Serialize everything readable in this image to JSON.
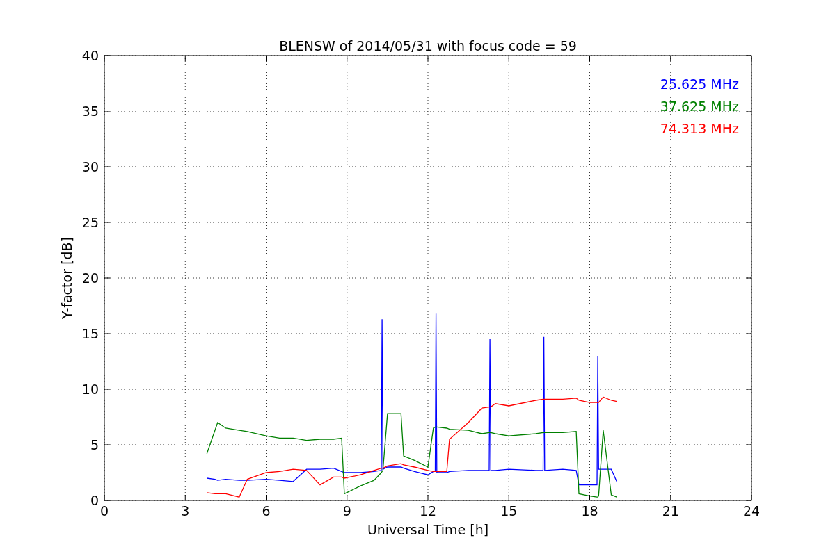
{
  "figure": {
    "chart_data": {
      "type": "line",
      "title": "BLENSW of 2014/05/31 with focus code = 59",
      "xlabel": "Universal Time [h]",
      "ylabel": "Y-factor [dB]",
      "grid": true,
      "x": [
        3.8,
        4.1,
        4.2,
        4.5,
        5.0,
        5.3,
        6.0,
        6.5,
        7.0,
        7.5,
        8.0,
        8.5,
        8.8,
        8.9,
        9.5,
        10.0,
        10.27,
        10.3,
        10.33,
        10.5,
        11.0,
        11.1,
        11.5,
        12.0,
        12.2,
        12.27,
        12.3,
        12.33,
        12.7,
        12.8,
        13.5,
        14.0,
        14.27,
        14.3,
        14.33,
        14.5,
        15.0,
        16.0,
        16.27,
        16.3,
        16.33,
        17.0,
        17.5,
        17.6,
        18.0,
        18.27,
        18.3,
        18.33,
        18.5,
        18.8,
        19.0
      ],
      "series": [
        {
          "name": "25.625 MHz",
          "color": "#0000ff",
          "values": [
            2.0,
            1.9,
            1.8,
            1.9,
            1.8,
            1.8,
            1.9,
            1.8,
            1.7,
            2.8,
            2.8,
            2.9,
            2.6,
            2.5,
            2.5,
            2.6,
            2.7,
            16.3,
            2.8,
            3.0,
            3.0,
            2.9,
            2.6,
            2.3,
            2.6,
            2.6,
            16.8,
            2.5,
            2.5,
            2.6,
            2.7,
            2.7,
            2.7,
            14.5,
            2.7,
            2.7,
            2.8,
            2.7,
            2.7,
            14.7,
            2.7,
            2.8,
            2.7,
            1.4,
            1.4,
            1.4,
            13.0,
            2.8,
            2.8,
            2.8,
            1.7
          ]
        },
        {
          "name": "37.625 MHz",
          "color": "#008000",
          "values": [
            4.2,
            6.3,
            7.0,
            6.5,
            6.3,
            6.2,
            5.8,
            5.6,
            5.6,
            5.4,
            5.5,
            5.5,
            5.6,
            0.6,
            1.3,
            1.8,
            2.5,
            2.6,
            2.7,
            7.8,
            7.8,
            4.0,
            3.6,
            3.0,
            6.5,
            6.6,
            6.6,
            6.6,
            6.5,
            6.4,
            6.3,
            6.0,
            6.1,
            6.1,
            6.1,
            6.0,
            5.8,
            6.0,
            6.1,
            6.1,
            6.1,
            6.1,
            6.2,
            0.6,
            0.4,
            0.3,
            0.3,
            0.4,
            6.3,
            0.5,
            0.3
          ]
        },
        {
          "name": "74.313 MHz",
          "color": "#ff0000",
          "values": [
            0.7,
            0.6,
            0.6,
            0.6,
            0.3,
            1.9,
            2.5,
            2.6,
            2.8,
            2.7,
            1.4,
            2.1,
            2.1,
            2.0,
            2.3,
            2.7,
            2.9,
            2.9,
            2.9,
            3.1,
            3.3,
            3.2,
            3.0,
            2.7,
            2.6,
            2.6,
            2.6,
            2.6,
            2.6,
            5.5,
            7.0,
            8.3,
            8.4,
            8.4,
            8.4,
            8.7,
            8.5,
            9.0,
            9.1,
            9.1,
            9.1,
            9.1,
            9.2,
            9.0,
            8.8,
            8.8,
            8.8,
            8.8,
            9.3,
            9.0,
            8.9
          ]
        }
      ],
      "xlim": [
        0,
        24
      ],
      "ylim": [
        0,
        40
      ],
      "xticks": [
        0,
        3,
        6,
        9,
        12,
        15,
        18,
        21,
        24
      ],
      "yticks": [
        0,
        5,
        10,
        15,
        20,
        25,
        30,
        35,
        40
      ]
    }
  }
}
